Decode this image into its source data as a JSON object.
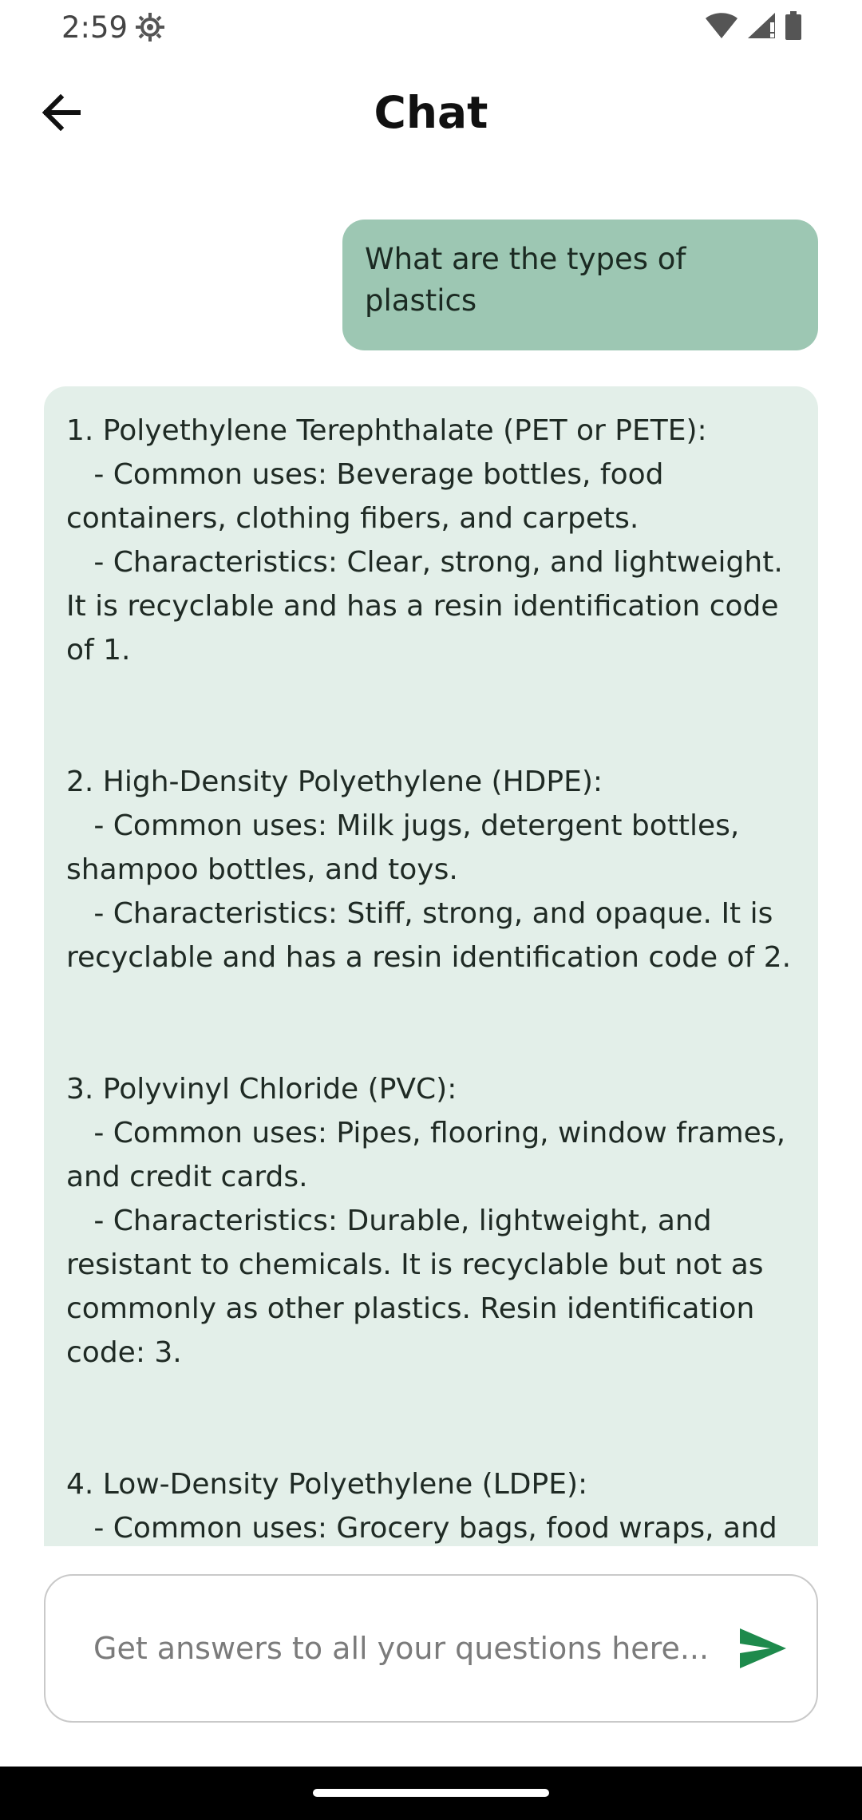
{
  "status_bar": {
    "time": "2:59",
    "icons": [
      "gear-icon",
      "wifi-icon",
      "signal-icon",
      "battery-icon"
    ]
  },
  "app_bar": {
    "title": "Chat",
    "back_icon": "arrow-left-icon"
  },
  "colors": {
    "user_bubble": "#9dc7b3",
    "bot_bubble": "#e3efe9",
    "send_icon": "#1e8a4c",
    "nav_bar": "#000000"
  },
  "messages": {
    "user": {
      "text": "What are the types of plastics"
    },
    "bot": {
      "paragraphs": [
        "1. Polyethylene Terephthalate (PET or PETE):\n   - Common uses: Beverage bottles, food containers, clothing fibers, and carpets.\n   - Characteristics: Clear, strong, and lightweight. It is recyclable and has a resin identification code of 1.",
        "2. High-Density Polyethylene (HDPE):\n   - Common uses: Milk jugs, detergent bottles, shampoo bottles, and toys.\n   - Characteristics: Stiff, strong, and opaque. It is recyclable and has a resin identification code of 2.",
        "3. Polyvinyl Chloride (PVC):\n   - Common uses: Pipes, flooring, window frames, and credit cards.\n   - Characteristics: Durable, lightweight, and resistant to chemicals. It is recyclable but not as commonly as other plastics. Resin identification code: 3.",
        "4. Low-Density Polyethylene (LDPE):\n   - Common uses: Grocery bags, food wraps, and"
      ]
    }
  },
  "input": {
    "placeholder": "Get answers to all your questions here...",
    "value": "",
    "send_icon": "send-icon"
  }
}
